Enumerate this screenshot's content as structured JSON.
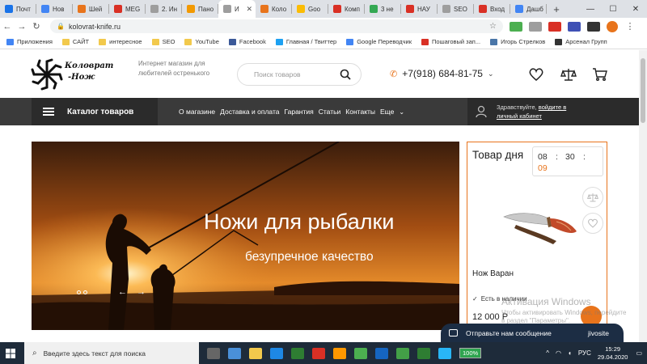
{
  "browser": {
    "tabs": [
      {
        "label": "Почт",
        "color": "#1a73e8"
      },
      {
        "label": "Нов",
        "color": "#4285f4"
      },
      {
        "label": "Шей",
        "color": "#e8741c"
      },
      {
        "label": "MEG",
        "color": "#d93025"
      },
      {
        "label": "2. Ин",
        "color": "#9e9e9e"
      },
      {
        "label": "Пано",
        "color": "#f29900"
      },
      {
        "label": "И",
        "color": "#9e9e9e",
        "active": true
      },
      {
        "label": "Коло",
        "color": "#e8741c"
      },
      {
        "label": "Goo",
        "color": "#fbbc04"
      },
      {
        "label": "Комп",
        "color": "#d93025"
      },
      {
        "label": "3 не",
        "color": "#34a853"
      },
      {
        "label": "НАУ",
        "color": "#d93025"
      },
      {
        "label": "SEO",
        "color": "#9e9e9e"
      },
      {
        "label": "Вход",
        "color": "#d93025"
      },
      {
        "label": "Дашб",
        "color": "#4285f4"
      }
    ],
    "new_tab": "+",
    "url": "kolovrat-knife.ru",
    "bookmarks": [
      {
        "label": "Приложения",
        "kind": "apps"
      },
      {
        "label": "САЙТ",
        "kind": "folder"
      },
      {
        "label": "интересное",
        "kind": "folder"
      },
      {
        "label": "SEO",
        "kind": "folder"
      },
      {
        "label": "YouTube",
        "kind": "folder"
      },
      {
        "label": "Facebook",
        "kind": "facebook"
      },
      {
        "label": "Главная / Твиттер",
        "kind": "twitter"
      },
      {
        "label": "Google Переводчик",
        "kind": "translate"
      },
      {
        "label": "Пошаговый зап...",
        "kind": "pin"
      },
      {
        "label": "Игорь Стрелков",
        "kind": "vk"
      },
      {
        "label": "Арсенал Групп",
        "kind": "arsenal"
      }
    ]
  },
  "site": {
    "logo_line1": "Коловрат",
    "logo_line2": "-Нож",
    "tagline": "Интернет магазин для любителей остренького",
    "search_placeholder": "Поиск товаров",
    "phone": "+7(918) 684-81-75",
    "catalog_label": "Каталог товаров",
    "menu": [
      "О магазине",
      "Доставка и оплата",
      "Гарантия",
      "Статьи",
      "Контакты",
      "Еще"
    ],
    "account_greeting": "Здравствуйте,",
    "account_link1": "войдите в",
    "account_link2": "личный кабинет",
    "hero_title": "Ножи для рыбалки",
    "hero_subtitle": "безупречное качество",
    "deal": {
      "title": "Товар дня",
      "hours": "08",
      "minutes": "30",
      "seconds": "09",
      "product_name": "Нож Варан",
      "stock": "Есть в наличии",
      "price": "12 000 Р"
    },
    "chat_label": "Отправьте нам сообщение",
    "chat_brand": "jivosite",
    "watermark_title": "Активация Windows",
    "watermark_text": "Чтобы активировать Windows, перейдите в раздел \"Параметры\"."
  },
  "taskbar": {
    "search_placeholder": "Введите здесь текст для поиска",
    "battery": "100%",
    "lang": "РУС",
    "time": "15:29",
    "date": "29.04.2020"
  },
  "colors": {
    "accent": "#e8741c",
    "nav_dark": "#3a3a3a",
    "chat_bg": "#1c2d44"
  }
}
